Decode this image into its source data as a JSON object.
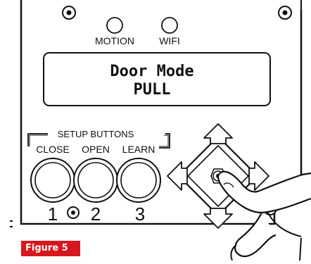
{
  "indicators": {
    "motion_label": "MOTION",
    "wifi_label": "WIFI"
  },
  "display": {
    "line1": "Door Mode",
    "line2": "PULL"
  },
  "setup": {
    "group_label": "SETUP BUTTONS",
    "buttons": [
      {
        "label": "CLOSE",
        "number": "1"
      },
      {
        "label": "OPEN",
        "number": "2"
      },
      {
        "label": "LEARN",
        "number": "3"
      }
    ]
  },
  "figure_caption": "Figure 5",
  "colors": {
    "caption_background": "#d6171d",
    "caption_text": "#ffffff",
    "line": "#111111"
  }
}
